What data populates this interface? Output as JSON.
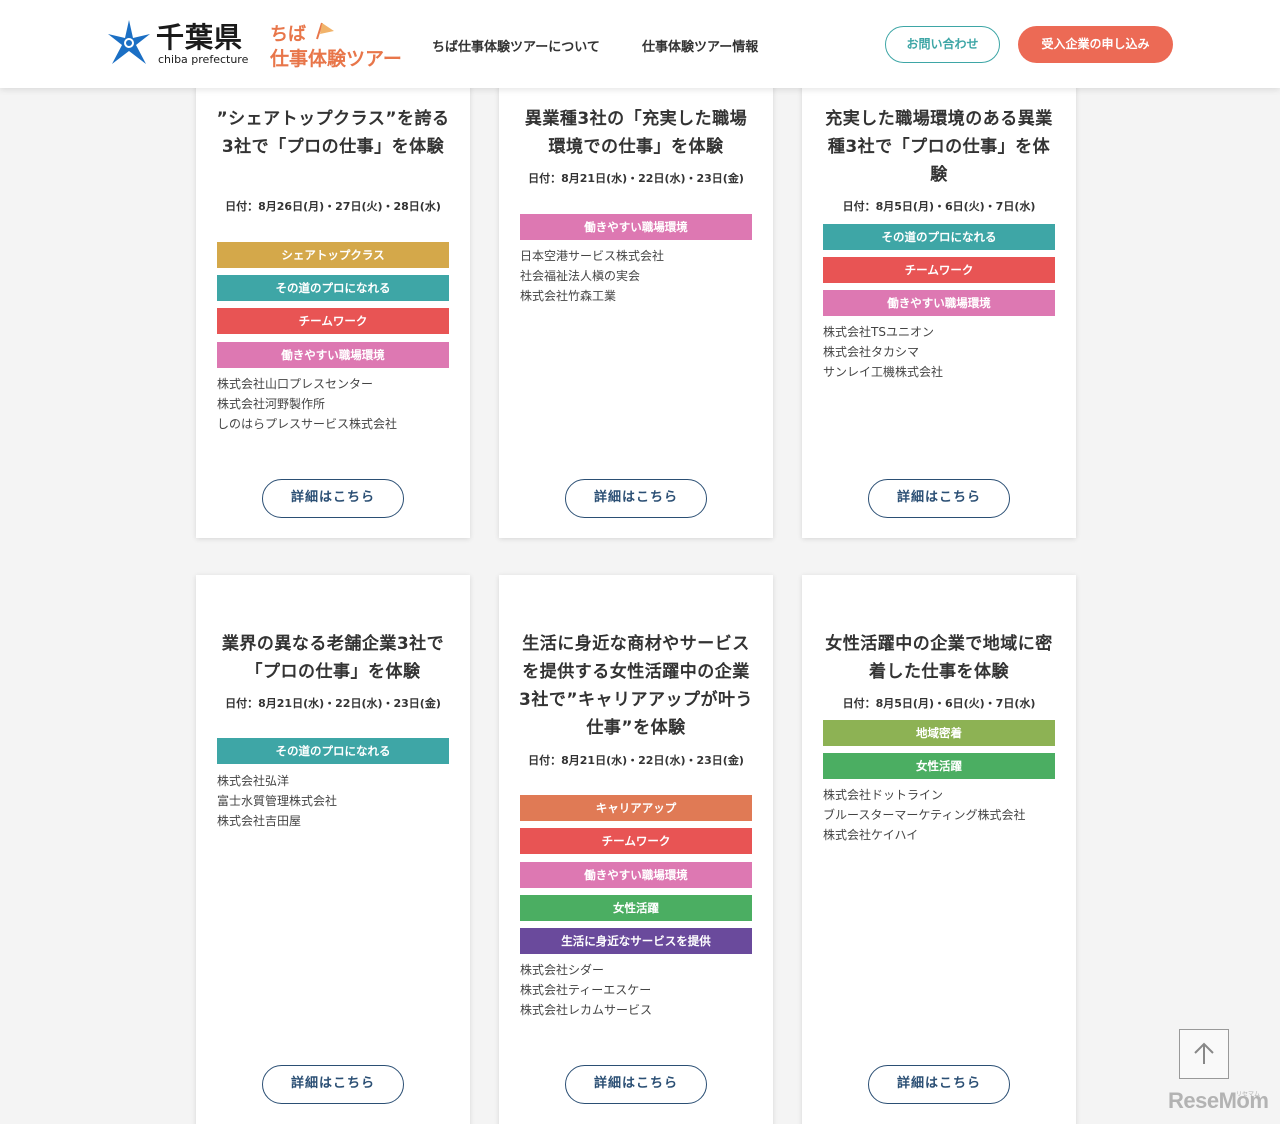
{
  "header": {
    "logo_jp": "千葉県",
    "logo_en": "chiba prefecture",
    "tour_logo_line1": "ちば",
    "tour_logo_line2": "仕事体験ツアー",
    "nav": [
      "ちば仕事体験ツアーについて",
      "仕事体験ツアー情報"
    ],
    "contact_label": "お問い合わせ",
    "apply_label": "受入企業の申し込み"
  },
  "colors": {
    "share_top": "#d4a84a",
    "pro": "#3ea6a6",
    "teamwork": "#e85454",
    "workplace": "#dd78b2",
    "career": "#e07a55",
    "women": "#4bae62",
    "local": "#8db254",
    "service": "#6a4a9c"
  },
  "cards": [
    {
      "title": "”シェアトップクラス”を誇る3社で「プロの仕事」を体験",
      "date": "日付：8月26日(月)・27日(火)・28日(水)",
      "tags": [
        {
          "label": "シェアトップクラス",
          "color": "#d4a84a"
        },
        {
          "label": "その道のプロになれる",
          "color": "#3ea6a6"
        },
        {
          "label": "チームワーク",
          "color": "#e85454"
        },
        {
          "label": "働きやすい職場環境",
          "color": "#dd78b2"
        }
      ],
      "companies": [
        "株式会社山口プレスセンター",
        "株式会社河野製作所",
        "しのはらプレスサービス株式会社"
      ],
      "detail_label": "詳細はこちら"
    },
    {
      "title": "異業種3社の「充実した職場環境での仕事」を体験",
      "date": "日付：8月21日(水)・22日(水)・23日(金)",
      "tags": [
        {
          "label": "働きやすい職場環境",
          "color": "#dd78b2"
        }
      ],
      "companies": [
        "日本空港サービス株式会社",
        "社会福祉法人槇の実会",
        "株式会社竹森工業"
      ],
      "detail_label": "詳細はこちら"
    },
    {
      "title": "充実した職場環境のある異業種3社で「プロの仕事」を体験",
      "date": "日付：8月5日(月)・6日(火)・7日(水)",
      "tags": [
        {
          "label": "その道のプロになれる",
          "color": "#3ea6a6"
        },
        {
          "label": "チームワーク",
          "color": "#e85454"
        },
        {
          "label": "働きやすい職場環境",
          "color": "#dd78b2"
        }
      ],
      "companies": [
        "株式会社TSユニオン",
        "株式会社タカシマ",
        "サンレイ工機株式会社"
      ],
      "detail_label": "詳細はこちら"
    },
    {
      "title": "業界の異なる老舗企業3社で「プロの仕事」を体験",
      "date": "日付：8月21日(水)・22日(水)・23日(金)",
      "tags": [
        {
          "label": "その道のプロになれる",
          "color": "#3ea6a6"
        }
      ],
      "companies": [
        "株式会社弘洋",
        "富士水質管理株式会社",
        "株式会社吉田屋"
      ],
      "detail_label": "詳細はこちら"
    },
    {
      "title": "生活に身近な商材やサービスを提供する女性活躍中の企業3社で”キャリアアップが叶う仕事”を体験",
      "date": "日付：8月21日(水)・22日(水)・23日(金)",
      "tags": [
        {
          "label": "キャリアアップ",
          "color": "#e07a55"
        },
        {
          "label": "チームワーク",
          "color": "#e85454"
        },
        {
          "label": "働きやすい職場環境",
          "color": "#dd78b2"
        },
        {
          "label": "女性活躍",
          "color": "#4bae62"
        },
        {
          "label": "生活に身近なサービスを提供",
          "color": "#6a4a9c"
        }
      ],
      "companies": [
        "株式会社シダー",
        "株式会社ティーエスケー",
        "株式会社レカムサービス"
      ],
      "detail_label": "詳細はこちら"
    },
    {
      "title": "女性活躍中の企業で地域に密着した仕事を体験",
      "date": "日付：8月5日(月)・6日(火)・7日(水)",
      "tags": [
        {
          "label": "地域密着",
          "color": "#8db254"
        },
        {
          "label": "女性活躍",
          "color": "#4bae62"
        }
      ],
      "companies": [
        "株式会社ドットライン",
        "ブルースターマーケティング株式会社",
        "株式会社ケイハイ"
      ],
      "detail_label": "詳細はこちら"
    }
  ],
  "watermark": "ReseMom",
  "watermark_small": "リセマム",
  "icons": {
    "to_top": "arrow-up-icon",
    "logo_mark": "chiba-star-icon"
  }
}
